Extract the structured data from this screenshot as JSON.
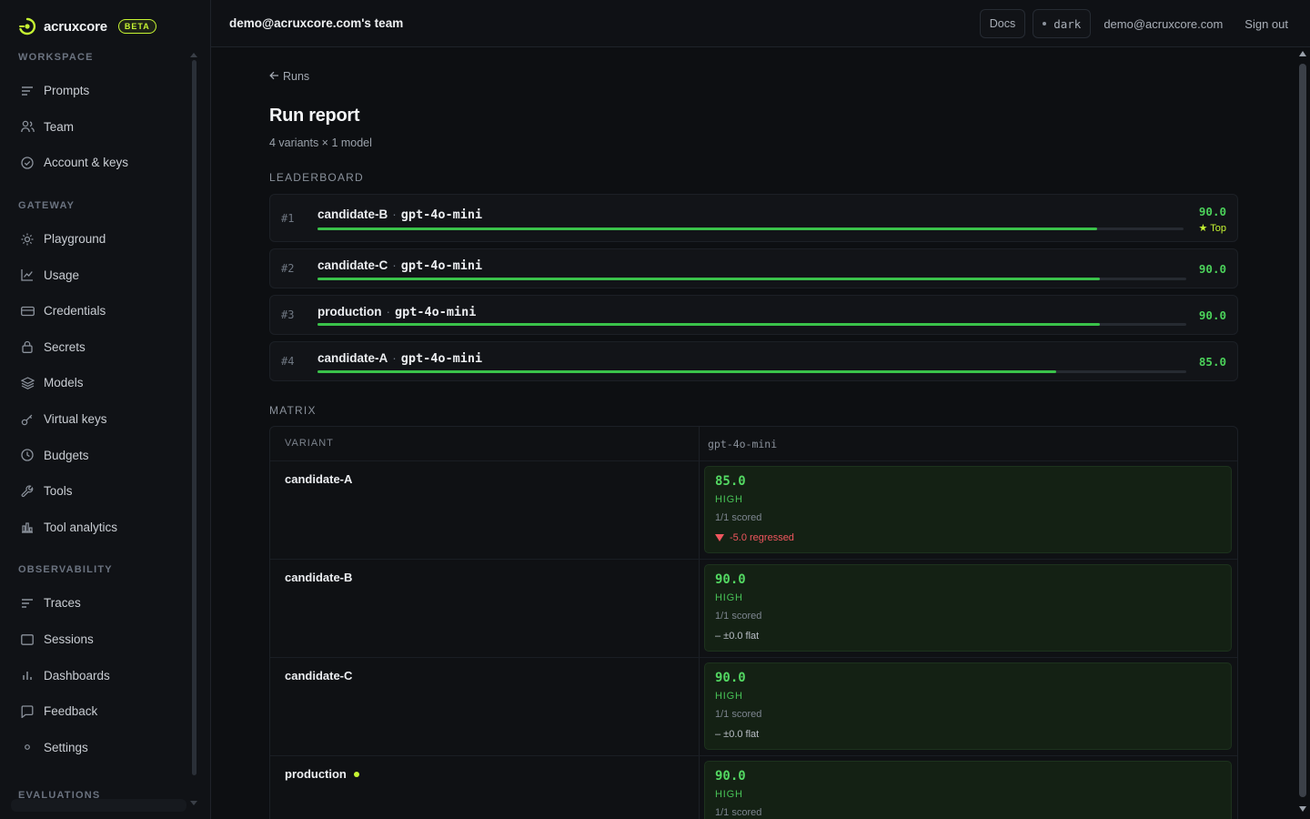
{
  "brand": {
    "name": "acruxcore",
    "badge": "BETA",
    "accent": "#c6f432"
  },
  "sidebar": {
    "sections": [
      {
        "label": "WORKSPACE",
        "items": [
          {
            "label": "Prompts",
            "icon": "list-icon"
          },
          {
            "label": "Team",
            "icon": "users-icon"
          },
          {
            "label": "Account & keys",
            "icon": "check-circle-icon"
          }
        ]
      },
      {
        "label": "GATEWAY",
        "items": [
          {
            "label": "Playground",
            "icon": "sun-icon"
          },
          {
            "label": "Usage",
            "icon": "line-chart-icon"
          },
          {
            "label": "Credentials",
            "icon": "card-icon"
          },
          {
            "label": "Secrets",
            "icon": "lock-icon"
          },
          {
            "label": "Models",
            "icon": "layers-icon"
          },
          {
            "label": "Virtual keys",
            "icon": "key-icon"
          },
          {
            "label": "Budgets",
            "icon": "clock-icon"
          },
          {
            "label": "Tools",
            "icon": "wrench-icon"
          },
          {
            "label": "Tool analytics",
            "icon": "bar-chart-icon"
          }
        ]
      },
      {
        "label": "OBSERVABILITY",
        "items": [
          {
            "label": "Traces",
            "icon": "traces-icon"
          },
          {
            "label": "Sessions",
            "icon": "window-icon"
          },
          {
            "label": "Dashboards",
            "icon": "columns-icon"
          },
          {
            "label": "Feedback",
            "icon": "message-icon"
          },
          {
            "label": "Settings",
            "icon": "dot-icon"
          }
        ]
      },
      {
        "label": "EVALUATIONS",
        "items": []
      }
    ]
  },
  "topbar": {
    "team": "demo@acruxcore.com's team",
    "docs": "Docs",
    "theme": "dark",
    "email": "demo@acruxcore.com",
    "signout": "Sign out"
  },
  "page": {
    "back": "Runs",
    "title": "Run report",
    "subtitle": "4 variants × 1 model",
    "leaderboard_label": "LEADERBOARD",
    "matrix_label": "MATRIX"
  },
  "leaderboard": [
    {
      "rank": "#1",
      "variant": "candidate-B",
      "model": "gpt-4o-mini",
      "score": "90.0",
      "fill": 0.9,
      "badge": "★ Top"
    },
    {
      "rank": "#2",
      "variant": "candidate-C",
      "model": "gpt-4o-mini",
      "score": "90.0",
      "fill": 0.9
    },
    {
      "rank": "#3",
      "variant": "production",
      "model": "gpt-4o-mini",
      "score": "90.0",
      "fill": 0.9
    },
    {
      "rank": "#4",
      "variant": "candidate-A",
      "model": "gpt-4o-mini",
      "score": "85.0",
      "fill": 0.85
    }
  ],
  "matrix": {
    "variant_header": "VARIANT",
    "model_header": "gpt-4o-mini",
    "rows": [
      {
        "variant": "candidate-A",
        "score": "85.0",
        "level": "HIGH",
        "scored": "1/1 scored",
        "delta": "-5.0 regressed",
        "trend": "down"
      },
      {
        "variant": "candidate-B",
        "score": "90.0",
        "level": "HIGH",
        "scored": "1/1 scored",
        "delta": "– ±0.0 flat",
        "trend": "flat"
      },
      {
        "variant": "candidate-C",
        "score": "90.0",
        "level": "HIGH",
        "scored": "1/1 scored",
        "delta": "– ±0.0 flat",
        "trend": "flat"
      },
      {
        "variant": "production",
        "score": "90.0",
        "level": "HIGH",
        "scored": "1/1 scored",
        "delta": "",
        "trend": "flat",
        "live": true
      }
    ]
  }
}
